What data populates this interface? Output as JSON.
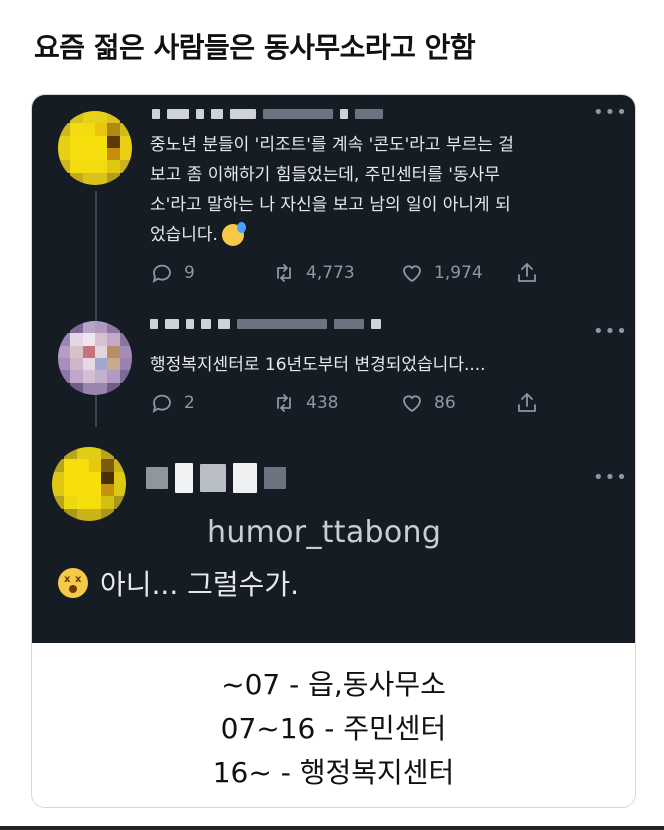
{
  "headline": "요즘 젊은 사람들은 동사무소라고 안함",
  "tweets": [
    {
      "text": "중노년 분들이 '리조트'를 계속 '콘도'라고 부르는 걸\n보고 좀 이해하기 힘들었는데, 주민센터를 '동사무\n소'라고 말하는 나 자신을 보고 남의 일이 아니게 되\n었습니다.",
      "replies": "9",
      "retweets": "4,773",
      "likes": "1,974"
    },
    {
      "text": "행정복지센터로 16년도부터 변경되었습니다....",
      "replies": "2",
      "retweets": "438",
      "likes": "86"
    }
  ],
  "watermark": "humor_ttabong",
  "reply_text": "아니... 그럴수가.",
  "caption_lines": [
    "~07 - 읍,동사무소",
    "07~16 - 주민센터",
    "16~ - 행정복지센터"
  ],
  "more_label": "•••",
  "icons": {
    "reply": "reply-icon",
    "retweet": "retweet-icon",
    "like": "like-icon",
    "share": "share-icon"
  },
  "colors": {
    "tweet_bg": "#151c24",
    "text": "#e7e9ea",
    "muted": "#8b98a5"
  }
}
